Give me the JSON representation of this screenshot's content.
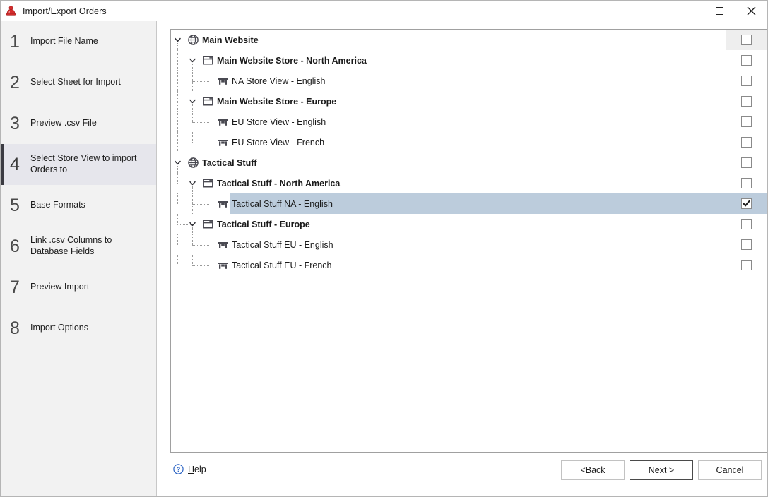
{
  "window": {
    "title": "Import/Export Orders",
    "app_icon": "app-logo-icon",
    "controls": {
      "maximize": "maximize-icon",
      "close": "close-icon"
    }
  },
  "sidebar": {
    "steps": [
      {
        "number": "1",
        "label": "Import File Name",
        "active": false
      },
      {
        "number": "2",
        "label": "Select Sheet for Import",
        "active": false
      },
      {
        "number": "3",
        "label": "Preview .csv File",
        "active": false
      },
      {
        "number": "4",
        "label": "Select Store View to import Orders to",
        "active": true
      },
      {
        "number": "5",
        "label": "Base Formats",
        "active": false
      },
      {
        "number": "6",
        "label": "Link .csv Columns to Database Fields",
        "active": false
      },
      {
        "number": "7",
        "label": "Preview Import",
        "active": false
      },
      {
        "number": "8",
        "label": "Import Options",
        "active": false
      }
    ]
  },
  "tree": {
    "rows": [
      {
        "label": "Main Website",
        "level": 0,
        "icon": "globe-icon",
        "bold": true,
        "expanded": true,
        "checked": false,
        "selected": false
      },
      {
        "label": "Main Website Store - North America",
        "level": 1,
        "icon": "store-icon",
        "bold": true,
        "expanded": true,
        "checked": false,
        "selected": false
      },
      {
        "label": "NA Store View - English",
        "level": 2,
        "icon": "store-view-icon",
        "bold": false,
        "expanded": null,
        "checked": false,
        "selected": false
      },
      {
        "label": "Main Website Store - Europe",
        "level": 1,
        "icon": "store-icon",
        "bold": true,
        "expanded": true,
        "checked": false,
        "selected": false
      },
      {
        "label": "EU Store View - English",
        "level": 2,
        "icon": "store-view-icon",
        "bold": false,
        "expanded": null,
        "checked": false,
        "selected": false
      },
      {
        "label": "EU Store View - French",
        "level": 2,
        "icon": "store-view-icon",
        "bold": false,
        "expanded": null,
        "checked": false,
        "selected": false
      },
      {
        "label": "Tactical Stuff",
        "level": 0,
        "icon": "globe-icon",
        "bold": true,
        "expanded": true,
        "checked": false,
        "selected": false
      },
      {
        "label": "Tactical Stuff - North America",
        "level": 1,
        "icon": "store-icon",
        "bold": true,
        "expanded": true,
        "checked": false,
        "selected": false
      },
      {
        "label": "Tactical Stuff NA - English",
        "level": 2,
        "icon": "store-view-icon",
        "bold": false,
        "expanded": null,
        "checked": true,
        "selected": true
      },
      {
        "label": "Tactical Stuff - Europe",
        "level": 1,
        "icon": "store-icon",
        "bold": true,
        "expanded": true,
        "checked": false,
        "selected": false
      },
      {
        "label": "Tactical Stuff EU - English",
        "level": 2,
        "icon": "store-view-icon",
        "bold": false,
        "expanded": null,
        "checked": false,
        "selected": false
      },
      {
        "label": "Tactical Stuff EU - French",
        "level": 2,
        "icon": "store-view-icon",
        "bold": false,
        "expanded": null,
        "checked": false,
        "selected": false
      }
    ]
  },
  "footer": {
    "help": {
      "icon": "help-circle-icon",
      "accel": "H",
      "rest": "elp"
    },
    "buttons": [
      {
        "name": "back-button",
        "pre": "< ",
        "accel": "B",
        "post": "ack",
        "default": false
      },
      {
        "name": "next-button",
        "pre": "",
        "accel": "N",
        "post": "ext >",
        "default": true
      },
      {
        "name": "cancel-button",
        "pre": "",
        "accel": "C",
        "post": "ancel",
        "default": false
      }
    ]
  },
  "colors": {
    "accent_active": "#3b3b42",
    "selection": "#bcccdc",
    "sidebar_bg": "#f2f2f2",
    "app_icon_red": "#d42c2c"
  }
}
